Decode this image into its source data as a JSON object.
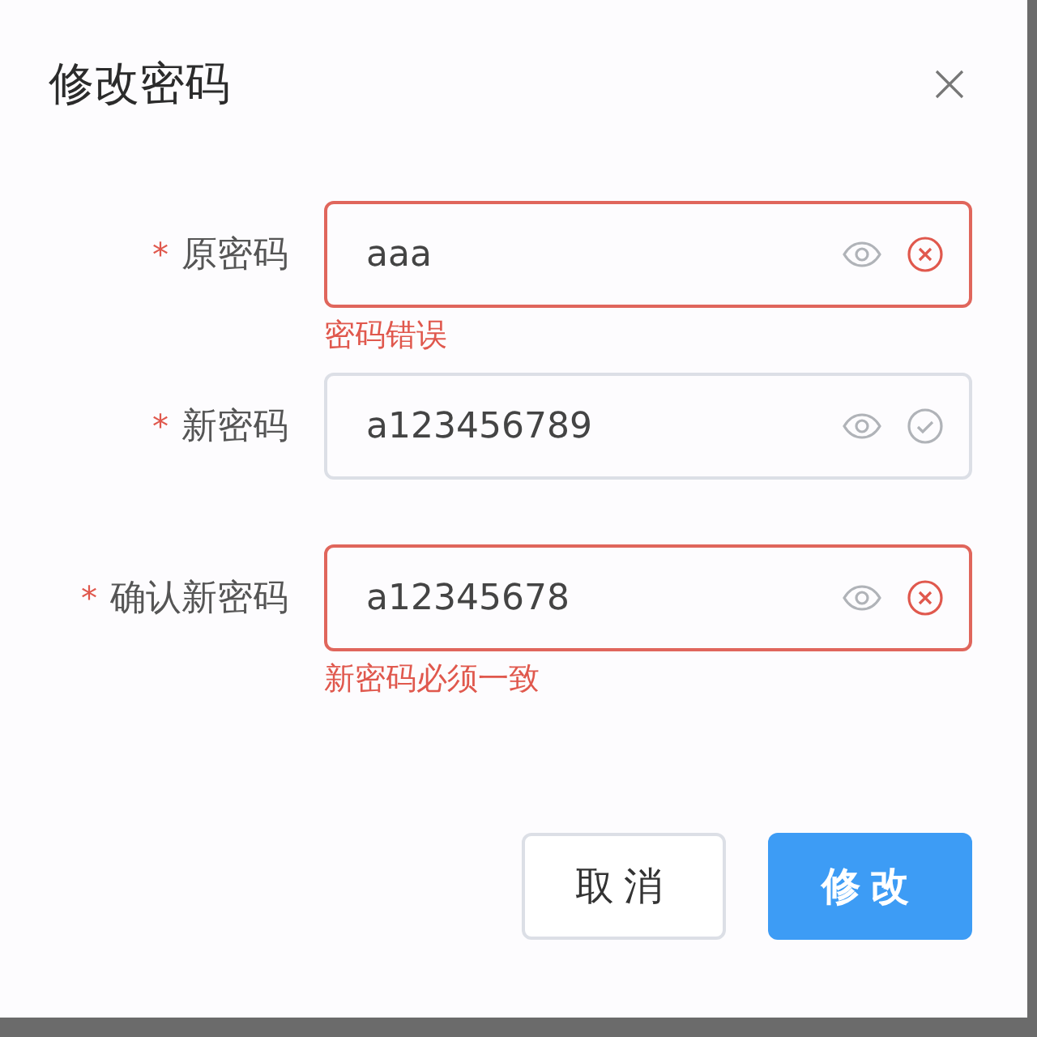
{
  "dialog": {
    "title": "修改密码"
  },
  "fields": [
    {
      "required_mark": "*",
      "label": "原密码",
      "value": "aaa",
      "valid": false,
      "error": "密码错误"
    },
    {
      "required_mark": "*",
      "label": "新密码",
      "value": "a123456789",
      "valid": true
    },
    {
      "required_mark": "*",
      "label": "确认新密码",
      "value": "a12345678",
      "valid": false,
      "error": "新密码必须一致"
    }
  ],
  "buttons": [
    {
      "label": "取消",
      "kind": "secondary"
    },
    {
      "label": "修改",
      "kind": "primary"
    }
  ]
}
